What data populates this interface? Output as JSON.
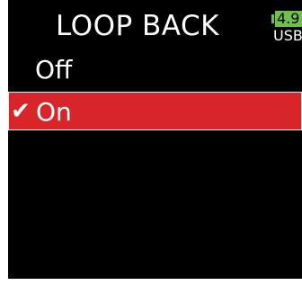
{
  "header": {
    "title": "LOOP BACK",
    "battery": {
      "level": "4.9",
      "source": "USB",
      "color": "#6fc04b"
    }
  },
  "menu": {
    "items": [
      {
        "label": "Off",
        "selected": false
      },
      {
        "label": "On",
        "selected": true,
        "check": "✔"
      }
    ],
    "highlight_color": "#d8252a"
  }
}
